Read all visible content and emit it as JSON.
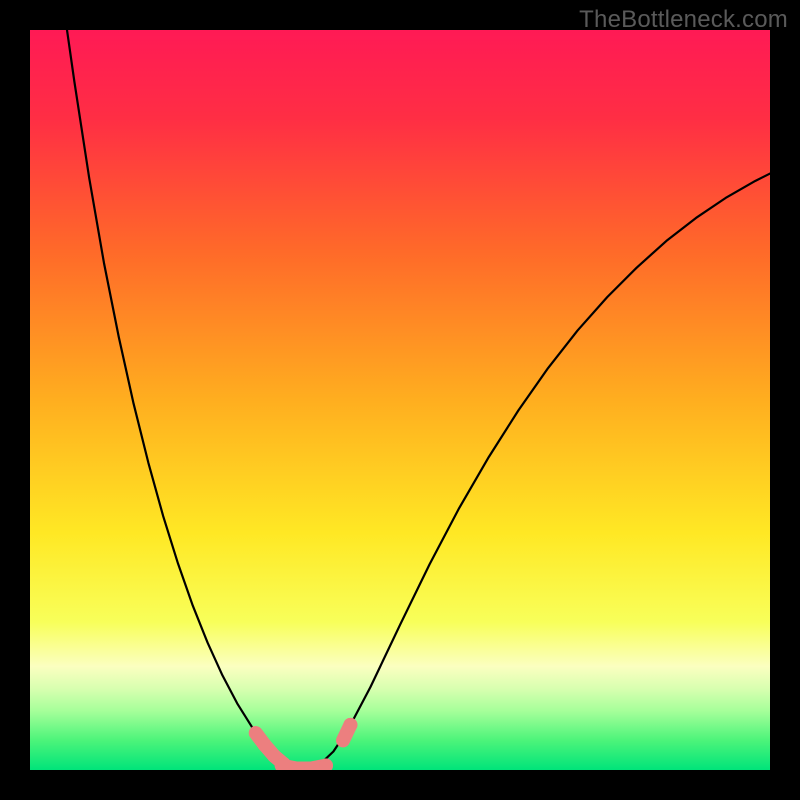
{
  "watermark": "TheBottleneck.com",
  "chart_data": {
    "type": "line",
    "title": "",
    "xlabel": "",
    "ylabel": "",
    "xlim": [
      0,
      100
    ],
    "ylim": [
      0,
      100
    ],
    "background": {
      "type": "vertical-gradient",
      "stops": [
        {
          "offset": 0.0,
          "color": "#ff1a55"
        },
        {
          "offset": 0.12,
          "color": "#ff2e44"
        },
        {
          "offset": 0.3,
          "color": "#ff6a29"
        },
        {
          "offset": 0.5,
          "color": "#ffae1f"
        },
        {
          "offset": 0.68,
          "color": "#ffe824"
        },
        {
          "offset": 0.8,
          "color": "#f8ff5a"
        },
        {
          "offset": 0.86,
          "color": "#fbffc0"
        },
        {
          "offset": 0.89,
          "color": "#d8ffb0"
        },
        {
          "offset": 0.92,
          "color": "#a6ff9a"
        },
        {
          "offset": 0.96,
          "color": "#4cf47a"
        },
        {
          "offset": 1.0,
          "color": "#00e47a"
        }
      ]
    },
    "series": [
      {
        "name": "left-branch",
        "color": "#000000",
        "width": 2.2,
        "points": [
          {
            "x": 5.0,
            "y": 100.0
          },
          {
            "x": 6.0,
            "y": 93.0
          },
          {
            "x": 8.0,
            "y": 80.0
          },
          {
            "x": 10.0,
            "y": 68.5
          },
          {
            "x": 12.0,
            "y": 58.5
          },
          {
            "x": 14.0,
            "y": 49.5
          },
          {
            "x": 16.0,
            "y": 41.5
          },
          {
            "x": 18.0,
            "y": 34.3
          },
          {
            "x": 20.0,
            "y": 27.9
          },
          {
            "x": 22.0,
            "y": 22.2
          },
          {
            "x": 24.0,
            "y": 17.2
          },
          {
            "x": 26.0,
            "y": 12.8
          },
          {
            "x": 28.0,
            "y": 9.0
          },
          {
            "x": 30.0,
            "y": 5.8
          },
          {
            "x": 31.5,
            "y": 3.8
          },
          {
            "x": 33.0,
            "y": 2.2
          },
          {
            "x": 34.5,
            "y": 1.0
          },
          {
            "x": 36.0,
            "y": 0.3
          },
          {
            "x": 37.5,
            "y": 0.0
          }
        ]
      },
      {
        "name": "right-branch",
        "color": "#000000",
        "width": 2.2,
        "points": [
          {
            "x": 37.5,
            "y": 0.0
          },
          {
            "x": 39.0,
            "y": 0.6
          },
          {
            "x": 41.0,
            "y": 2.5
          },
          {
            "x": 43.0,
            "y": 5.5
          },
          {
            "x": 46.0,
            "y": 11.2
          },
          {
            "x": 50.0,
            "y": 19.6
          },
          {
            "x": 54.0,
            "y": 27.8
          },
          {
            "x": 58.0,
            "y": 35.4
          },
          {
            "x": 62.0,
            "y": 42.3
          },
          {
            "x": 66.0,
            "y": 48.6
          },
          {
            "x": 70.0,
            "y": 54.3
          },
          {
            "x": 74.0,
            "y": 59.4
          },
          {
            "x": 78.0,
            "y": 63.9
          },
          {
            "x": 82.0,
            "y": 67.9
          },
          {
            "x": 86.0,
            "y": 71.5
          },
          {
            "x": 90.0,
            "y": 74.6
          },
          {
            "x": 94.0,
            "y": 77.3
          },
          {
            "x": 98.0,
            "y": 79.6
          },
          {
            "x": 100.0,
            "y": 80.6
          }
        ]
      },
      {
        "name": "pink-markers-left",
        "color": "#ec7f7f",
        "type": "marker-band",
        "width": 14,
        "points": [
          {
            "x": 30.5,
            "y": 5.0
          },
          {
            "x": 31.7,
            "y": 3.4
          },
          {
            "x": 33.0,
            "y": 1.9
          },
          {
            "x": 34.3,
            "y": 0.8
          }
        ]
      },
      {
        "name": "pink-markers-bottom",
        "color": "#ec7f7f",
        "type": "marker-band",
        "width": 14,
        "points": [
          {
            "x": 34.0,
            "y": 0.6
          },
          {
            "x": 36.0,
            "y": 0.2
          },
          {
            "x": 38.0,
            "y": 0.2
          },
          {
            "x": 40.0,
            "y": 0.6
          }
        ]
      },
      {
        "name": "pink-markers-right",
        "color": "#ec7f7f",
        "type": "marker-band",
        "width": 14,
        "points": [
          {
            "x": 42.3,
            "y": 4.0
          },
          {
            "x": 43.3,
            "y": 6.1
          }
        ]
      }
    ]
  }
}
